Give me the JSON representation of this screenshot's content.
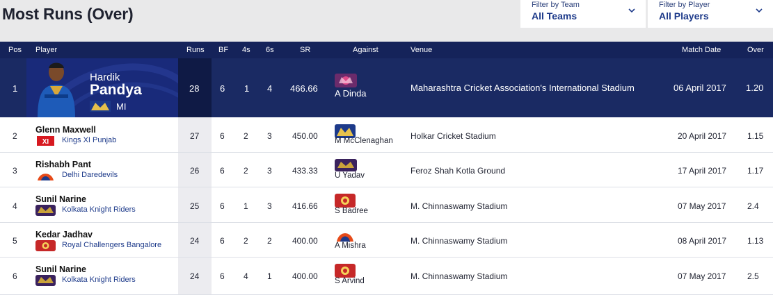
{
  "page": {
    "title": "Most Runs (Over)"
  },
  "filters": {
    "team": {
      "label": "Filter by Team",
      "value": "All Teams"
    },
    "player": {
      "label": "Filter by Player",
      "value": "All Players"
    }
  },
  "table": {
    "headers": [
      "Pos",
      "Player",
      "Runs",
      "BF",
      "4s",
      "6s",
      "SR",
      "Against",
      "Venue",
      "Match Date",
      "Over"
    ],
    "featured": {
      "pos": "1",
      "first_name": "Hardik",
      "last_name": "Pandya",
      "team": "MI",
      "runs": "28",
      "bf": "6",
      "fours": "1",
      "sixes": "4",
      "sr": "466.66",
      "against": "A Dinda",
      "venue": "Maharashtra Cricket Association's International Stadium",
      "date": "06 April 2017",
      "over": "1.20"
    },
    "rows": [
      {
        "pos": "2",
        "player": "Glenn Maxwell",
        "team": "Kings XI Punjab",
        "runs": "27",
        "bf": "6",
        "fours": "2",
        "sixes": "3",
        "sr": "450.00",
        "against": "M McClenaghan",
        "venue": "Holkar Cricket Stadium",
        "date": "20 April 2017",
        "over": "1.15"
      },
      {
        "pos": "3",
        "player": "Rishabh Pant",
        "team": "Delhi Daredevils",
        "runs": "26",
        "bf": "6",
        "fours": "2",
        "sixes": "3",
        "sr": "433.33",
        "against": "U Yadav",
        "venue": "Feroz Shah Kotla Ground",
        "date": "17 April 2017",
        "over": "1.17"
      },
      {
        "pos": "4",
        "player": "Sunil Narine",
        "team": "Kolkata Knight Riders",
        "runs": "25",
        "bf": "6",
        "fours": "1",
        "sixes": "3",
        "sr": "416.66",
        "against": "S Badree",
        "venue": "M. Chinnaswamy Stadium",
        "date": "07 May 2017",
        "over": "2.4"
      },
      {
        "pos": "5",
        "player": "Kedar Jadhav",
        "team": "Royal Challengers Bangalore",
        "runs": "24",
        "bf": "6",
        "fours": "2",
        "sixes": "2",
        "sr": "400.00",
        "against": "A Mishra",
        "venue": "M. Chinnaswamy Stadium",
        "date": "08 April 2017",
        "over": "1.13"
      },
      {
        "pos": "6",
        "player": "Sunil Narine",
        "team": "Kolkata Knight Riders",
        "runs": "24",
        "bf": "6",
        "fours": "4",
        "sixes": "1",
        "sr": "400.00",
        "against": "S Arvind",
        "venue": "M. Chinnaswamy Stadium",
        "date": "07 May 2017",
        "over": "2.5"
      }
    ]
  },
  "colors": {
    "header_bg": "#15235a",
    "featured_bg": "#1a2a63",
    "accent": "#1d3a8a"
  },
  "logos": {
    "featured_team": "mi-logo-icon",
    "featured_against": "rps-logo-icon",
    "rows_team": [
      "kxip-logo-icon",
      "dd-logo-icon",
      "kkr-logo-icon",
      "rcb-logo-icon",
      "kkr-logo-icon"
    ],
    "rows_against": [
      "mi-logo-icon",
      "kkr-logo-icon",
      "rcb-logo-icon",
      "dd-logo-icon",
      "rcb-logo-icon"
    ]
  }
}
